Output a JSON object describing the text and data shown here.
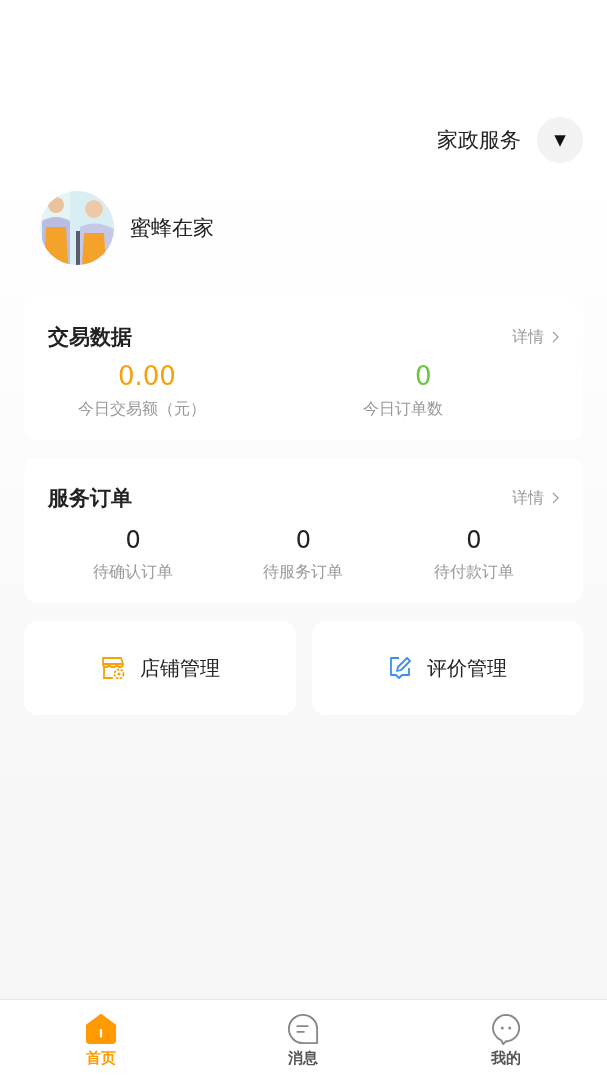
{
  "header": {
    "category": "家政服务",
    "dropdown_icon": "▼"
  },
  "profile": {
    "name": "蜜蜂在家"
  },
  "trade_card": {
    "title": "交易数据",
    "detail_link": "详情",
    "stats": [
      {
        "value": "0.00",
        "label": "今日交易额（元）",
        "color": "#f5a00c"
      },
      {
        "value": "0",
        "label": "今日订单数",
        "color": "#6cc43c"
      }
    ]
  },
  "order_card": {
    "title": "服务订单",
    "detail_link": "详情",
    "stats": [
      {
        "value": "0",
        "label": "待确认订单"
      },
      {
        "value": "0",
        "label": "待服务订单"
      },
      {
        "value": "0",
        "label": "待付款订单"
      }
    ]
  },
  "shortcuts": [
    {
      "kind": "store",
      "label": "店铺管理"
    },
    {
      "kind": "review",
      "label": "评价管理"
    }
  ],
  "tab_bar": [
    {
      "kind": "home",
      "label": "首页",
      "selected": true
    },
    {
      "kind": "message",
      "label": "消息",
      "selected": false
    },
    {
      "kind": "profile",
      "label": "我的",
      "selected": false
    }
  ]
}
